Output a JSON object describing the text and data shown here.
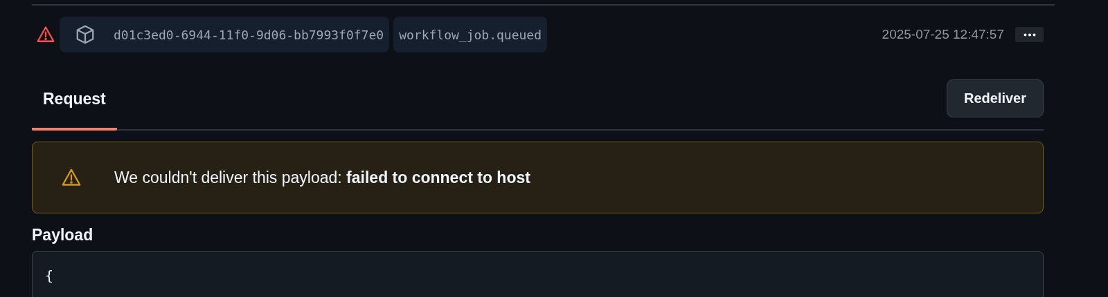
{
  "delivery": {
    "failed": true,
    "guid": "d01c3ed0-6944-11f0-9d06-bb7993f0f7e0",
    "event": "workflow_job.queued",
    "time": "2025-07-25 12:47:57"
  },
  "tabs": [
    {
      "label": "Request",
      "selected": true
    }
  ],
  "redeliver_button": "Redeliver",
  "alert": {
    "kind": "warning",
    "message": "We couldn't deliver this payload: **failed to connect to host**"
  },
  "payload": {
    "label": "Payload",
    "lines": [
      "{"
    ]
  }
}
